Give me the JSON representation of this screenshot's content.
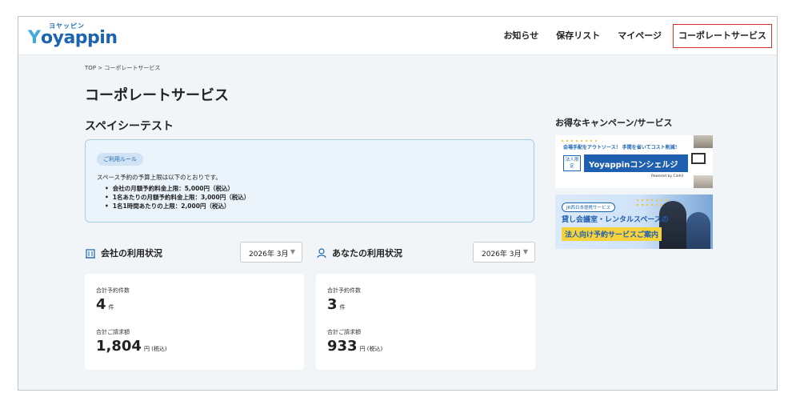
{
  "header": {
    "logo_kana": "ヨヤッピン",
    "logo_word": "oyappin",
    "logo_initial": "Y",
    "nav": [
      "お知らせ",
      "保存リスト",
      "マイページ",
      "コーポレートサービス"
    ]
  },
  "breadcrumb": "TOP > コーポレートサービス",
  "page_title": "コーポレートサービス",
  "section_title": "スペイシーテスト",
  "rules": {
    "badge": "ご利用ルール",
    "intro": "スペース予約の予算上限は以下のとおりです。",
    "items": [
      "会社の月額予約料金上限：5,000円（税込）",
      "1名あたりの月額予約料金上限：3,000円（税込）",
      "1名1時間あたりの上限：2,000円（税込）"
    ]
  },
  "company_usage": {
    "title": "会社の利用状況",
    "month": "2026年 3月",
    "count_label": "合計予約件数",
    "count_value": "4",
    "count_unit": "件",
    "amount_label": "合計ご請求額",
    "amount_value": "1,804",
    "amount_unit": "円 (税込)"
  },
  "my_usage": {
    "title": "あなたの利用状況",
    "month": "2026年 3月",
    "count_label": "合計予約件数",
    "count_value": "3",
    "count_unit": "件",
    "amount_label": "合計ご請求額",
    "amount_value": "933",
    "amount_unit": "円 (税込)"
  },
  "sidebar": {
    "title": "お得なキャンペーン/サービス",
    "banner1": {
      "top_text": "会場手配をアウトソース！ 手間を省いてコスト削減！",
      "tag": "法人限定",
      "main": "Yoyappinコンシェルジュ",
      "powered": "Powered by Ciehil"
    },
    "banner2": {
      "tag": "JR西日本提携サービス",
      "line1": "貸し会議室・レンタルスペースの",
      "line2": "法人向け予約サービスご案内"
    }
  },
  "colors": {
    "brand_blue": "#1b64b1",
    "active_border": "#d9302a",
    "page_bg": "#f1f5f8"
  }
}
